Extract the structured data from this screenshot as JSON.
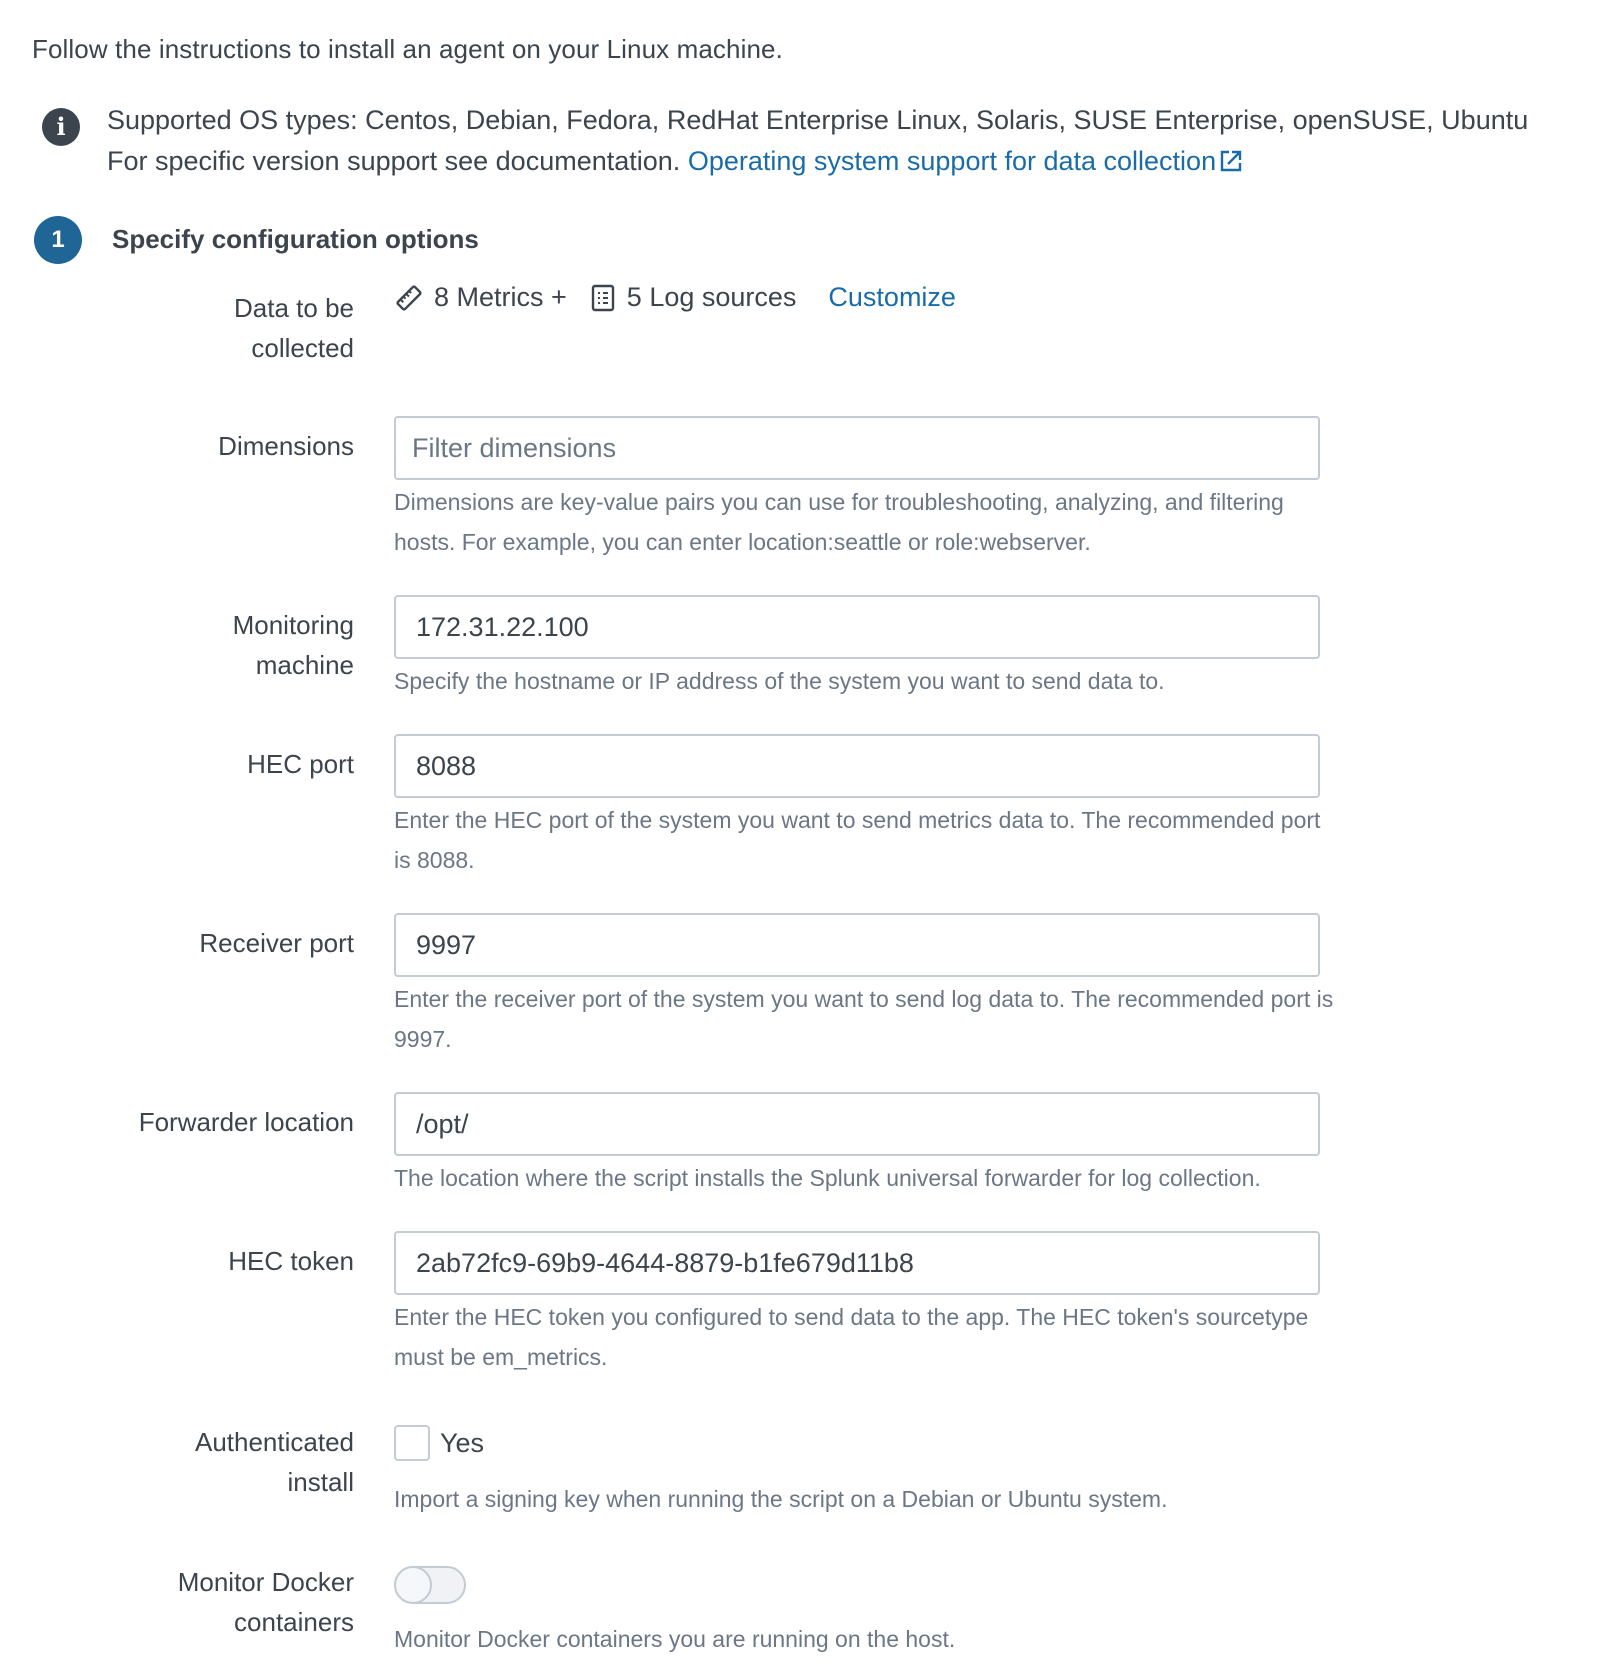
{
  "intro": "Follow the instructions to install an agent on your Linux machine.",
  "info": {
    "icon": "info-icon",
    "supported_os": "Supported OS types: Centos, Debian, Fedora, RedHat Enterprise Linux, Solaris, SUSE Enterprise, openSUSE, Ubuntu",
    "doc_text": "For specific version support see documentation.",
    "doc_link": "Operating system support for data collection",
    "doc_link_icon": "external-link-icon"
  },
  "step": {
    "number": "1",
    "title": "Specify configuration options"
  },
  "colors": {
    "link": "#1a6ca8",
    "step_badge": "#1f6596",
    "text": "#3c444d",
    "help_text": "#6b7785",
    "border": "#c3cbd4"
  },
  "form": {
    "data_collected": {
      "label_line1": "Data to be",
      "label_line2": "collected",
      "metrics_icon": "ruler-icon",
      "metrics": "8 Metrics +",
      "logs_icon": "document-list-icon",
      "logs": "5 Log sources",
      "customize": "Customize"
    },
    "dimensions": {
      "label": "Dimensions",
      "value": "",
      "placeholder": "Filter dimensions",
      "help": "Dimensions are key-value pairs you can use for troubleshooting, analyzing, and filtering hosts. For example, you can enter location:seattle or role:webserver."
    },
    "monitoring_machine": {
      "label_line1": "Monitoring",
      "label_line2": "machine",
      "value": "172.31.22.100",
      "help": "Specify the hostname or IP address of the system you want to send data to."
    },
    "hec_port": {
      "label": "HEC port",
      "value": "8088",
      "help": "Enter the HEC port of the system you want to send metrics data to. The recommended port is 8088."
    },
    "receiver_port": {
      "label": "Receiver port",
      "value": "9997",
      "help": "Enter the receiver port of the system you want to send log data to. The recommended port is 9997."
    },
    "forwarder_location": {
      "label": "Forwarder location",
      "value": "/opt/",
      "help": "The location where the script installs the Splunk universal forwarder for log collection."
    },
    "hec_token": {
      "label": "HEC token",
      "value": "2ab72fc9-69b9-4644-8879-b1fe679d11b8",
      "help": "Enter the HEC token you configured to send data to the app. The HEC token's sourcetype must be em_metrics."
    },
    "authenticated_install": {
      "label_line1": "Authenticated",
      "label_line2": "install",
      "checkbox_label": "Yes",
      "checked": false,
      "help": "Import a signing key when running the script on a Debian or Ubuntu system."
    },
    "monitor_docker": {
      "label_line1": "Monitor Docker",
      "label_line2": "containers",
      "enabled": false,
      "help": "Monitor Docker containers you are running on the host."
    }
  }
}
